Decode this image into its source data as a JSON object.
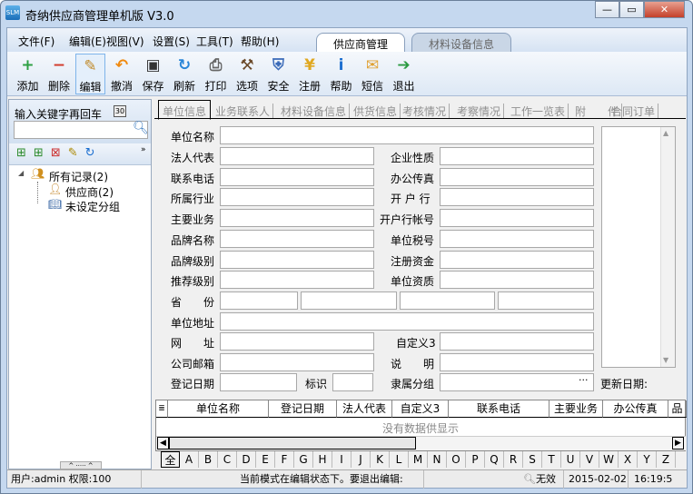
{
  "window": {
    "title": "奇纳供应商管理单机版 V3.0",
    "logo": "SLM"
  },
  "menu": [
    "文件(F)",
    "编辑(E)",
    "视图(V)",
    "设置(S)",
    "工具(T)",
    "帮助(H)"
  ],
  "top_tabs": [
    "供应商管理",
    "材料设备信息"
  ],
  "toolbar": [
    {
      "label": "添加",
      "icon": "add-icon",
      "glyph": "+",
      "color": "#2ea043"
    },
    {
      "label": "删除",
      "icon": "delete-icon",
      "glyph": "−",
      "color": "#d23b2b"
    },
    {
      "label": "编辑",
      "icon": "edit-icon",
      "glyph": "✎",
      "color": "#c08a2a"
    },
    {
      "label": "撤消",
      "icon": "undo-icon",
      "glyph": "↶",
      "color": "#f08a10"
    },
    {
      "label": "保存",
      "icon": "save-icon",
      "glyph": "▣",
      "color": "#333"
    },
    {
      "label": "刷新",
      "icon": "refresh-icon",
      "glyph": "↻",
      "color": "#2a86d8"
    },
    {
      "label": "打印",
      "icon": "print-icon",
      "glyph": "⎙",
      "color": "#666"
    },
    {
      "label": "选项",
      "icon": "tools-icon",
      "glyph": "⚒",
      "color": "#6b4a2a"
    },
    {
      "label": "安全",
      "icon": "shield-icon",
      "glyph": "⛨",
      "color": "#3a6ab8"
    },
    {
      "label": "注册",
      "icon": "yen-icon",
      "glyph": "¥",
      "color": "#e0a820"
    },
    {
      "label": "帮助",
      "icon": "info-icon",
      "glyph": "i",
      "color": "#1e6fd0"
    },
    {
      "label": "短信",
      "icon": "mail-icon",
      "glyph": "✉",
      "color": "#e0a030"
    },
    {
      "label": "退出",
      "icon": "exit-icon",
      "glyph": "➔",
      "color": "#2a9a40"
    }
  ],
  "sidebar": {
    "search_label": "输入关键字再回车",
    "search_value": "",
    "badge": "30",
    "tree": [
      {
        "label": "所有记录(2)"
      },
      {
        "label": "供应商(2)"
      },
      {
        "label": "未设定分组"
      }
    ]
  },
  "detail_tabs": [
    "单位信息",
    "业务联系人",
    "材料设备信息",
    "供货信息",
    "考核情况",
    "考察情况",
    "工作一览表",
    "附　　件",
    "合同订单"
  ],
  "form": {
    "unit_name": "单位名称",
    "legal_rep": "法人代表",
    "phone": "联系电话",
    "industry": "所属行业",
    "main_business": "主要业务",
    "brand_name": "品牌名称",
    "brand_level": "品牌级别",
    "recommend_level": "推荐级别",
    "nature": "企业性质",
    "fax": "办公传真",
    "bank": "开 户 行",
    "bank_account": "开户行帐号",
    "tax_no": "单位税号",
    "capital": "注册资金",
    "qualification": "单位资质",
    "province": "省　　份",
    "address": "单位地址",
    "website": "网　　址",
    "email": "公司邮箱",
    "custom3": "自定义3",
    "remark": "说　　明",
    "reg_date": "登记日期",
    "mark": "标识",
    "group": "隶属分组",
    "group_btn": "···",
    "update_date": "更新日期:"
  },
  "grid": {
    "columns": [
      "单位名称",
      "登记日期",
      "法人代表",
      "自定义3",
      "联系电话",
      "主要业务",
      "办公传真",
      "品"
    ],
    "empty": "没有数据供显示"
  },
  "alphabet": [
    "全",
    "A",
    "B",
    "C",
    "D",
    "E",
    "F",
    "G",
    "H",
    "I",
    "J",
    "K",
    "L",
    "M",
    "N",
    "O",
    "P",
    "Q",
    "R",
    "S",
    "T",
    "U",
    "V",
    "W",
    "X",
    "Y",
    "Z"
  ],
  "status": {
    "user": "用户:admin  权限:100",
    "message": "当前模式在编辑状态下。要退出编辑:",
    "search": "无效",
    "date": "2015-02-02",
    "time": "16:19:5"
  }
}
